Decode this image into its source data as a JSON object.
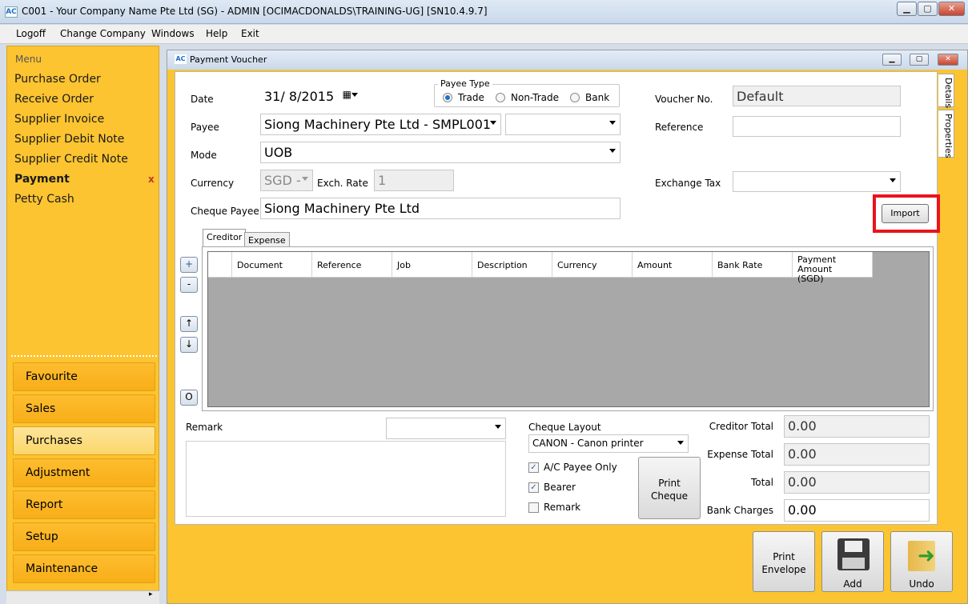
{
  "window": {
    "title": "C001 - Your Company Name Pte Ltd (SG) - ADMIN [OCIMACDONALDS\\TRAINING-UG] [SN10.4.9.7]",
    "icon": "AC",
    "controls": [
      "minimize-icon",
      "maximize-icon",
      "close-icon"
    ]
  },
  "menubar": [
    "Logoff",
    "Change Company",
    "Windows",
    "Help",
    "Exit"
  ],
  "sidebar": {
    "header": "Menu",
    "items": [
      "Purchase Order",
      "Receive Order",
      "Supplier Invoice",
      "Supplier Debit Note",
      "Payment",
      "Petty Cash"
    ],
    "active_item": "Payment",
    "close_mark": "x",
    "categories": [
      "Favourite",
      "Sales",
      "Purchases",
      "Adjustment",
      "Report",
      "Setup",
      "Maintenance"
    ],
    "active_category": "Purchases"
  },
  "doc": {
    "title": "Payment Voucher",
    "icon": "AC",
    "side_tabs": [
      "Details",
      "Properties"
    ],
    "date_label": "Date",
    "date_value": "31/  8/2015",
    "payee_type": {
      "legend": "Payee Type",
      "options": [
        "Trade",
        "Non-Trade",
        "Bank"
      ],
      "selected": "Trade"
    },
    "voucher_label": "Voucher No.",
    "voucher_value": "Default",
    "payee_label": "Payee",
    "payee_value": "Siong Machinery Pte Ltd - SMPL001",
    "payee_extra": "",
    "reference_label": "Reference",
    "reference_value": "",
    "mode_label": "Mode",
    "mode_value": "UOB",
    "currency_label": "Currency",
    "currency_value": "SGD -",
    "exch_label": "Exch. Rate",
    "exch_value": "1",
    "exchange_tax_label": "Exchange Tax",
    "exchange_tax_value": "",
    "cheque_payee_label": "Cheque Payee",
    "cheque_payee_value": "Siong Machinery Pte Ltd",
    "import_label": "Import",
    "tabs": [
      "Creditor",
      "Expense"
    ],
    "active_tab": "Creditor",
    "grid_buttons": [
      "+",
      "-",
      "↑",
      "↓",
      "O"
    ],
    "grid_columns": [
      "Document",
      "Reference",
      "Job",
      "Description",
      "Currency",
      "Amount",
      "Bank Rate",
      "Payment Amount\n(SGD)"
    ],
    "remark_label": "Remark",
    "remark_value": "",
    "remark_select": "",
    "cheque_layout_label": "Cheque Layout",
    "cheque_layout_value": "CANON - Canon printer",
    "checks": [
      {
        "label": "A/C Payee Only",
        "checked": true
      },
      {
        "label": "Bearer",
        "checked": true
      },
      {
        "label": "Remark",
        "checked": false
      }
    ],
    "print_cheque": "Print\nCheque",
    "totals": [
      {
        "label": "Creditor Total",
        "value": "0.00"
      },
      {
        "label": "Expense Total",
        "value": "0.00"
      },
      {
        "label": "Total",
        "value": "0.00"
      },
      {
        "label": "Bank Charges",
        "value": "0.00"
      }
    ],
    "buttons": {
      "print_envelope": "Print\nEnvelope",
      "add": "Add",
      "undo": "Undo"
    }
  }
}
